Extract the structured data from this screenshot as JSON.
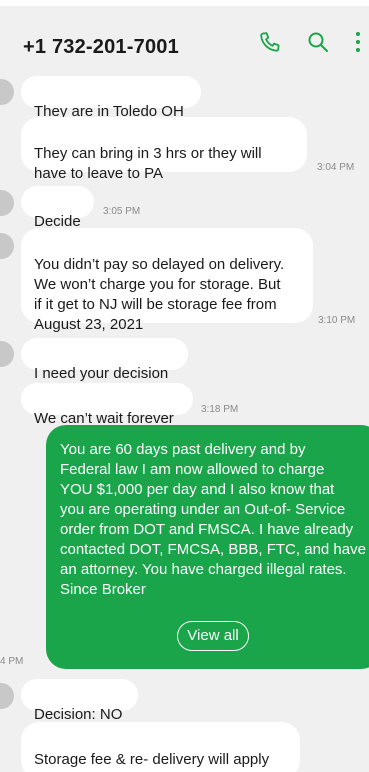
{
  "header": {
    "title": "+1 732-201-7001",
    "icons": [
      "phone-icon",
      "search-icon",
      "more-vertical-icon"
    ]
  },
  "messages": [
    {
      "text": "They are in Toledo OH"
    },
    {
      "text": "They can bring in 3 hrs or they will\nhave to leave to PA",
      "time": "3:04 PM"
    },
    {
      "text": "Decide",
      "time": "3:05 PM"
    },
    {
      "text": "You didn’t pay so delayed on delivery.\nWe won’t charge you for storage. But\nif it get to NJ will be storage fee from\nAugust 23, 2021",
      "time": "3:10 PM"
    },
    {
      "text": "I need your decision"
    },
    {
      "text": "We can’t wait forever",
      "time": "3:18 PM"
    },
    {
      "text": "Decision: NO"
    },
    {
      "text": "Storage fee & re- delivery will apply\nseparately"
    }
  ],
  "outgoing": {
    "text": "You are 60 days past delivery and by\nFederal law I am now allowed to charge\nYOU $1,000 per day and I also know that\nyou are operating under an Out-of- Service\norder from DOT and FMSCA. I have already\ncontacted DOT, FMCSA, BBB, FTC, and have\nan attorney. You have charged illegal rates.\nSince Broker",
    "view_all_label": "View all",
    "time_partial": "4 PM"
  },
  "colors": {
    "background": "#f0f0f0",
    "incoming_bubble": "#ffffff",
    "outgoing_bubble": "#1aa54a",
    "accent": "#1aa54a"
  }
}
